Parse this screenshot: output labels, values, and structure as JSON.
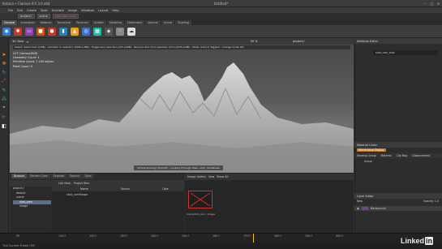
{
  "window": {
    "app_title": "Katana • Clarisse iFX 3.0 x64",
    "doc_title": "Untitled*"
  },
  "menu": [
    "File",
    "Edit",
    "Create",
    "Tools",
    "Animate",
    "Image",
    "Windows",
    "Layout",
    "Help"
  ],
  "path": {
    "items": [
      "project:/",
      "scene",
      "shot_cam_shot"
    ]
  },
  "shelf_tabs": [
    "General",
    "Animation",
    "Material",
    "Transform",
    "Particles",
    "Scatter",
    "Modeling",
    "Deformers",
    "Volume",
    "Scene",
    "Shading"
  ],
  "viewport": {
    "title": "3d View",
    "zoom": "50 %",
    "context": "project:/",
    "tip": "Select: Select item (LMB) - Add item to selection (Shift+LMB) - Toggle item selection (Ctrl+LMB) - Remove item from selection (Ctrl+Shift+LMB) - Mode: Auto(T) Toggled - Change mode (M)",
    "hud": [
      "LUT: Clarisse|RGB",
      "Geometry Count: 1",
      "Primitive Count: 7.105 million",
      "Point Count: 0"
    ],
    "status": "Simple Shading (Smooth) - Looking Through: Item: shot_cam(Node)"
  },
  "browser": {
    "tabs": [
      "Browser",
      "Render Cube",
      "Explorer",
      "Search",
      "Sync"
    ],
    "list_view": "List View",
    "project_item": "Project Item",
    "col_name": "Name",
    "col_source": "Source",
    "col_cat": "Cate",
    "tree": [
      "project:/",
      "default",
      "scene",
      "shot_cam",
      "image"
    ],
    "file": "shot_camShape"
  },
  "gallery": {
    "title": "Image Gallery",
    "new_label": "New",
    "show_all": "Show All",
    "thumb_label": "/cam/shot_cam / image"
  },
  "attr_editor": {
    "title": "Attribute Editor",
    "field": "shot_cam_shot"
  },
  "material_linker": {
    "title": "Material Linker",
    "filter": "Hierarchical Display",
    "cols": [
      "Shading Group",
      "Material",
      "Clip Map",
      "Displacement"
    ],
    "row": "Group"
  },
  "layer_editor": {
    "title": "Layer Editor",
    "new": "New",
    "opacity": "Opacity: 1.0",
    "row": "Background"
  },
  "timeline": {
    "ticks": [
      "110 f",
      "120 f",
      "130 f",
      "140 f",
      "150 f",
      "160 f",
      "170 f",
      "180 f",
      "190 f",
      "200 f",
      "210 f",
      "220 f",
      "230 f",
      "240 f",
      "250 f"
    ],
    "current": "55",
    "end": "300 f"
  },
  "footer": {
    "text": "Tick Current Frame (55)"
  },
  "brand": {
    "name": "Linked",
    "suffix": "in"
  }
}
